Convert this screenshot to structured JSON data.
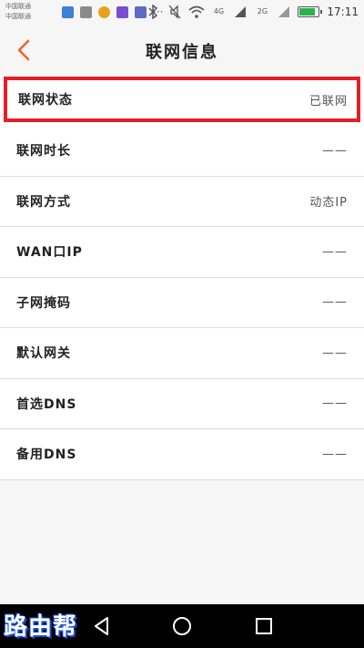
{
  "status_bar": {
    "carrier_1": "中国联通",
    "carrier_2": "中国联通",
    "net_1": "4G",
    "net_2": "2G",
    "time": "17:11"
  },
  "header": {
    "title": "联网信息",
    "back_icon": "chevron-left-icon"
  },
  "rows": [
    {
      "label": "联网状态",
      "value": "已联网"
    },
    {
      "label": "联网时长",
      "value": "——"
    },
    {
      "label": "联网方式",
      "value": "动态IP"
    },
    {
      "label": "WAN口IP",
      "value": "——"
    },
    {
      "label": "子网掩码",
      "value": "——"
    },
    {
      "label": "默认网关",
      "value": "——"
    },
    {
      "label": "首选DNS",
      "value": "——"
    },
    {
      "label": "备用DNS",
      "value": "——"
    }
  ],
  "watermark": "路由帮",
  "colors": {
    "accent": "#f0642d",
    "highlight_border": "#e51e26",
    "background": "#f6f6f6"
  }
}
